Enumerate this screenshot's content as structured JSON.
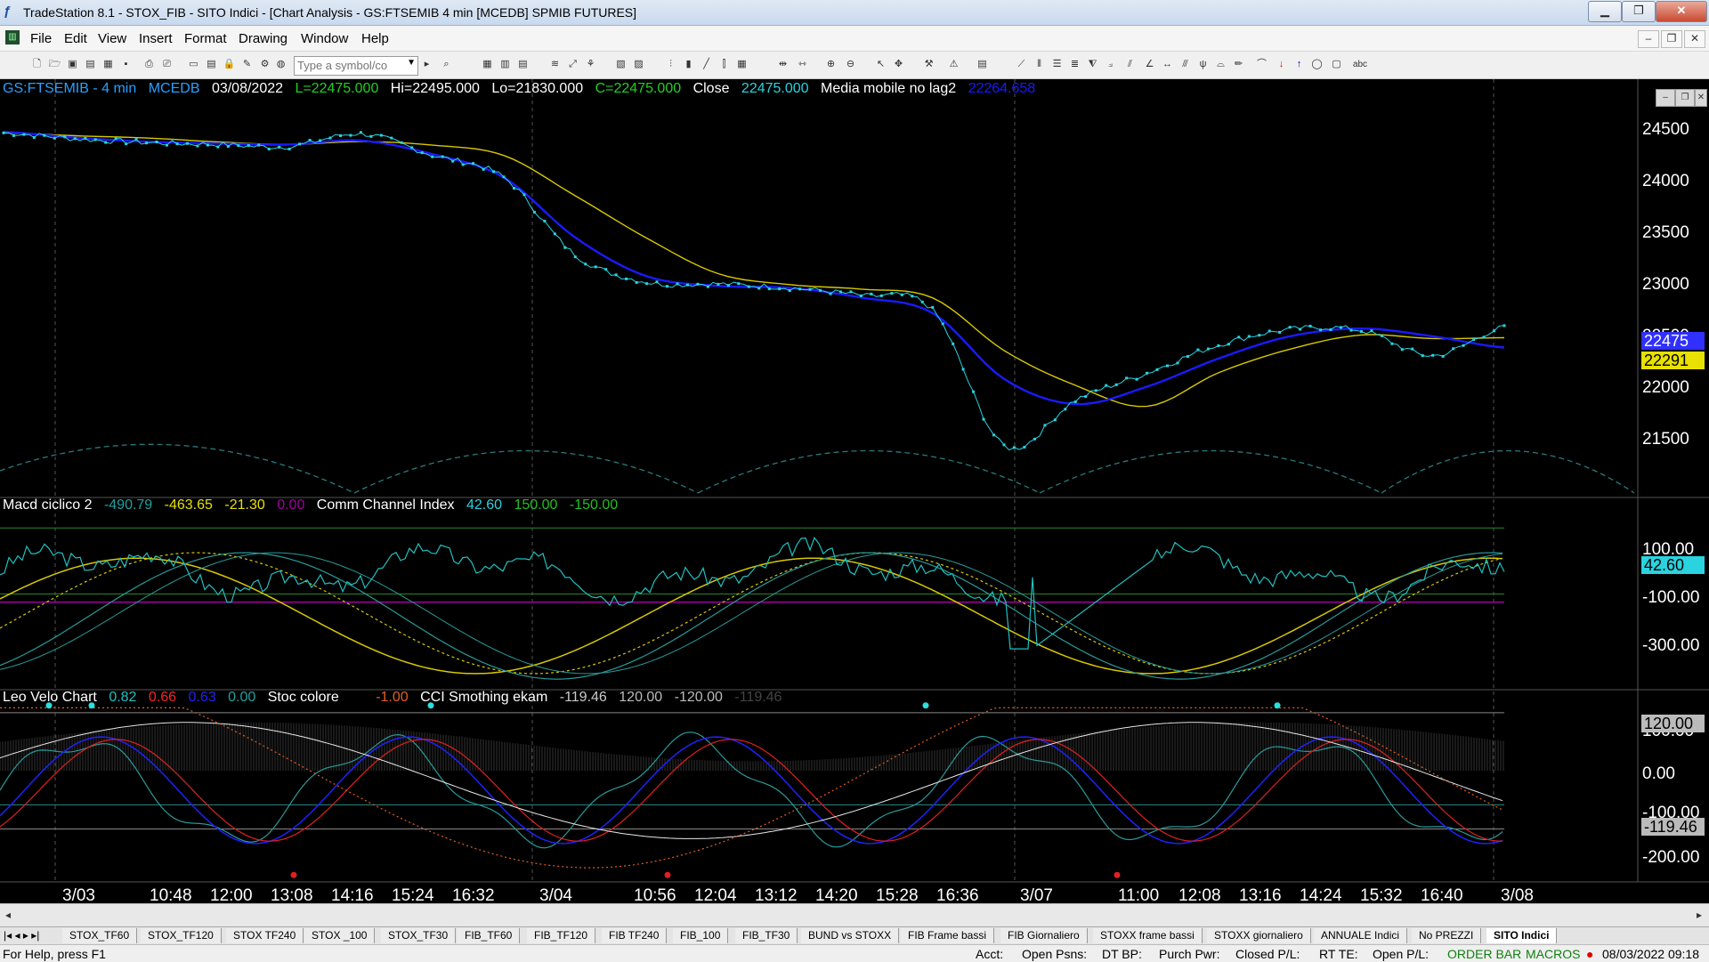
{
  "window": {
    "title": "TradeStation 8.1 - STOX_FIB - SITO Indici - [Chart Analysis - GS:FTSEMIB  4 min  [MCEDB] SPMIB FUTURES]",
    "minimize_label": "▁",
    "maximize_label": "❐",
    "close_label": "✕"
  },
  "menu": {
    "items": [
      "File",
      "Edit",
      "View",
      "Insert",
      "Format",
      "Drawing",
      "Window",
      "Help"
    ],
    "mdi_min": "–",
    "mdi_restore": "❐",
    "mdi_close": "✕"
  },
  "toolbar": {
    "symbol_placeholder": "Type a symbol/co",
    "text_tool_label": "abc"
  },
  "header": {
    "symbol": "GS:FTSEMIB - 4 min",
    "exchange": "MCEDB",
    "date": "03/08/2022",
    "last": "L=22475.000",
    "high": "Hi=22495.000",
    "low": "Lo=21830.000",
    "close_val": "C=22475.000",
    "close_label": "Close",
    "close_value": "22475.000",
    "ma_label": "Media mobile no lag2",
    "ma_value": "22264.658"
  },
  "panel2": {
    "macd_label": "Macd ciclico 2",
    "v1": "-490.79",
    "v2": "-463.65",
    "v3": "-21.30",
    "v4": "0.00",
    "cci_label": "Comm Channel Index",
    "cci_value": "42.60",
    "cci_upper": "150.00",
    "cci_lower": "-150.00"
  },
  "panel3": {
    "leo_label": "Leo Velo Chart",
    "v1": "0.82",
    "v2": "0.66",
    "v3": "0.63",
    "v4": "0.00",
    "stoc_label": "Stoc colore",
    "stoc_value": "-1.00",
    "cci_smooth_label": "CCI Smothing ekam",
    "c1": "-119.46",
    "c2": "120.00",
    "c3": "-120.00",
    "c4": "-119.46"
  },
  "price_axis": {
    "ticks": [
      "24500",
      "24000",
      "23500",
      "23000",
      "22500",
      "22000",
      "21500"
    ],
    "last_badge": "22475",
    "ma_badge": "22291"
  },
  "osc_axis": {
    "ticks": [
      "100.00",
      "-100.00",
      "-300.00"
    ],
    "badge": "42.60"
  },
  "cci_axis": {
    "ticks": [
      "100.00",
      "0.00",
      "-100.00",
      "-200.00"
    ],
    "upper_badge": "120.00",
    "lower_badge": "-119.46"
  },
  "time_axis": [
    "3/03",
    "10:48",
    "12:00",
    "13:08",
    "14:16",
    "15:24",
    "16:32",
    "3/04",
    "10:56",
    "12:04",
    "13:12",
    "14:20",
    "15:28",
    "16:36",
    "3/07",
    "11:00",
    "12:08",
    "13:16",
    "14:24",
    "15:32",
    "16:40",
    "3/08"
  ],
  "tabs": [
    "STOX_TF60",
    "STOX_TF120",
    "STOX TF240",
    "STOX _100",
    "STOX_TF30",
    "FIB_TF60",
    "FIB_TF120",
    "FIB TF240",
    "FIB_100",
    "FIB_TF30",
    "BUND vs STOXX",
    "FIB Frame bassi",
    "FIB Giornaliero",
    "STOXX frame bassi",
    "STOXX giornaliero",
    "ANNUALE Indici",
    "No PREZZI",
    "SITO Indici"
  ],
  "active_tab": "SITO Indici",
  "status": {
    "help": "For Help, press F1",
    "acct": "Acct:",
    "open_psns": "Open Psns:",
    "dt_bp": "DT BP:",
    "purch_pwr": "Purch Pwr:",
    "closed_pl": "Closed P/L:",
    "rt_te": "RT TE:",
    "open_pl": "Open P/L:",
    "order_bar": "ORDER BAR",
    "macros": "MACROS",
    "datetime": "08/03/2022 09:18"
  },
  "colors": {
    "price_dots": "#29d3e0",
    "ma_blue": "#1a1aff",
    "ma_yellow": "#d8c800",
    "cci_line": "#20c0c0",
    "red": "#e02020",
    "orange": "#e06020",
    "green_text": "#20c020",
    "magenta": "#a000a0"
  },
  "chart_data": [
    {
      "type": "line",
      "title": "GS:FTSEMIB - 4 min",
      "xlabel": "",
      "ylabel": "",
      "ylim": [
        20900,
        24850
      ],
      "x": [
        "3/03",
        "10:48",
        "12:00",
        "13:08",
        "14:16",
        "15:24",
        "16:32",
        "3/04",
        "10:56",
        "12:04",
        "13:12",
        "14:20",
        "15:28",
        "16:36",
        "3/07",
        "11:00",
        "12:08",
        "13:16",
        "14:24",
        "15:32",
        "16:40",
        "3/08"
      ],
      "series": [
        {
          "name": "Close",
          "values": [
            24480,
            24420,
            24380,
            24360,
            24340,
            24470,
            24250,
            24020,
            23220,
            22940,
            22920,
            22880,
            22800,
            22650,
            21250,
            21720,
            22000,
            22290,
            22450,
            22440,
            22180,
            22475
          ]
        },
        {
          "name": "Media mobile no lag2",
          "values": [
            24490,
            24430,
            24390,
            24370,
            24360,
            24400,
            24260,
            24020,
            23400,
            23000,
            22900,
            22880,
            22780,
            22620,
            21940,
            21680,
            21860,
            22150,
            22380,
            22460,
            22380,
            22264
          ]
        }
      ]
    }
  ]
}
